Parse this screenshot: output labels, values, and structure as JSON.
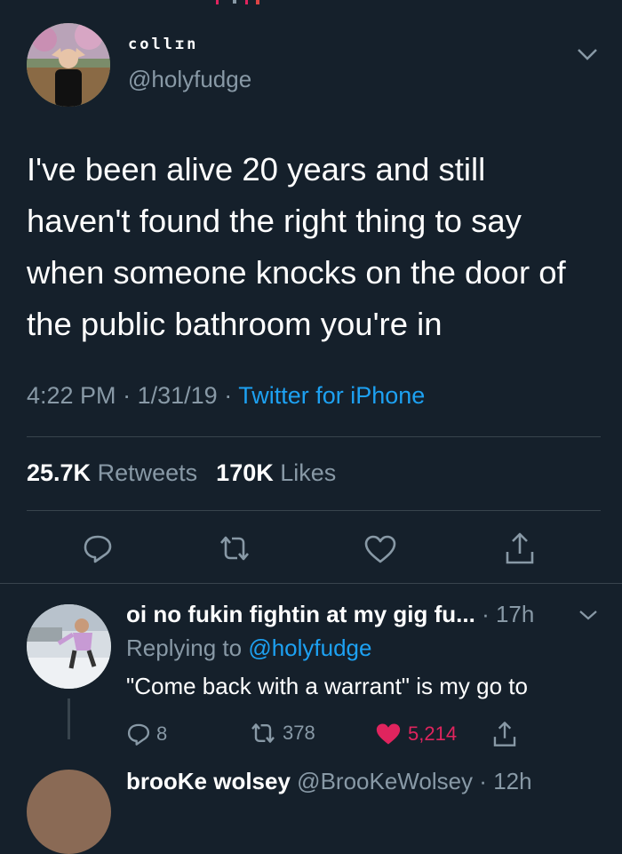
{
  "tweet": {
    "display_name": "collɪn",
    "handle": "@holyfudge",
    "text": "I've been alive 20 years and still haven't found the right thing to say when someone knocks on the door of the public bathroom you're in",
    "time": "4:22 PM",
    "date": "1/31/19",
    "source": "Twitter for iPhone",
    "retweets_count": "25.7K",
    "retweets_label": "Retweets",
    "likes_count": "170K",
    "likes_label": "Likes"
  },
  "reply": {
    "display_name": "oi no fukin fightin at my gig fu...",
    "age": "17h",
    "replying_prefix": "Replying to",
    "replying_handle": "@holyfudge",
    "text": "\"Come back with a warrant\" is my go to",
    "reply_count": "8",
    "retweet_count": "378",
    "like_count": "5,214"
  },
  "next_reply": {
    "display_name": "brooKe wolsey",
    "handle": "@BrooKeWolsey",
    "age": "12h"
  },
  "colors": {
    "background": "#15202b",
    "muted": "#8899a6",
    "link": "#1da1f2",
    "like": "#e0245e"
  }
}
